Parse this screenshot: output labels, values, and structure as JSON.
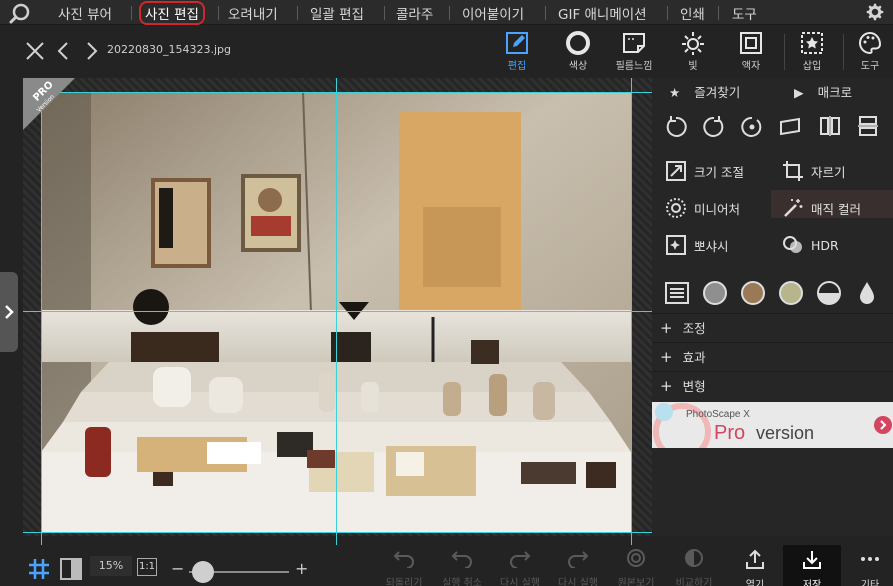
{
  "menu": {
    "items": [
      "사진 뷰어",
      "사진 편집",
      "오려내기",
      "일괄 편집",
      "콜라주",
      "이어붙이기",
      "GIF 애니메이션",
      "인쇄",
      "도구"
    ],
    "active_index": 1
  },
  "file": {
    "name": "20220830_154323.jpg"
  },
  "toolbar": {
    "tools": [
      {
        "label": "편집",
        "icon": "edit-icon",
        "active": true
      },
      {
        "label": "색상",
        "icon": "color-circle-icon"
      },
      {
        "label": "필름느낌",
        "icon": "film-icon"
      },
      {
        "label": "빛",
        "icon": "light-sun-icon"
      },
      {
        "label": "액자",
        "icon": "frame-icon"
      },
      {
        "label": "삽입",
        "icon": "insert-star-icon"
      },
      {
        "label": "도구",
        "icon": "palette-icon"
      }
    ]
  },
  "canvas": {
    "badge_main": "PRO",
    "badge_sub": "Version"
  },
  "panel": {
    "favorites": "즐겨찾기",
    "macro": "매크로",
    "actions": {
      "resize": "크기 조절",
      "crop": "자르기",
      "miniature": "미니어처",
      "magic_color": "매직 컬러",
      "bloom": "뽀샤시",
      "hdr": "HDR"
    },
    "sections": [
      "조정",
      "효과",
      "변형"
    ],
    "promo": {
      "brand": "PhotoScape X",
      "pro": "Pro",
      "version": "version"
    }
  },
  "bottom": {
    "zoom": "15%",
    "one_to_one": "1:1",
    "history": [
      "되돌리기",
      "실행 취소",
      "다시 실행",
      "다시 실행 ...",
      "원본보기",
      "비교하기"
    ],
    "open": "열기",
    "save": "저장",
    "more": "기타"
  },
  "colors": {
    "accent": "#4aa3ff",
    "active_outline": "#d0282a",
    "guide": "#3ad1d8"
  }
}
